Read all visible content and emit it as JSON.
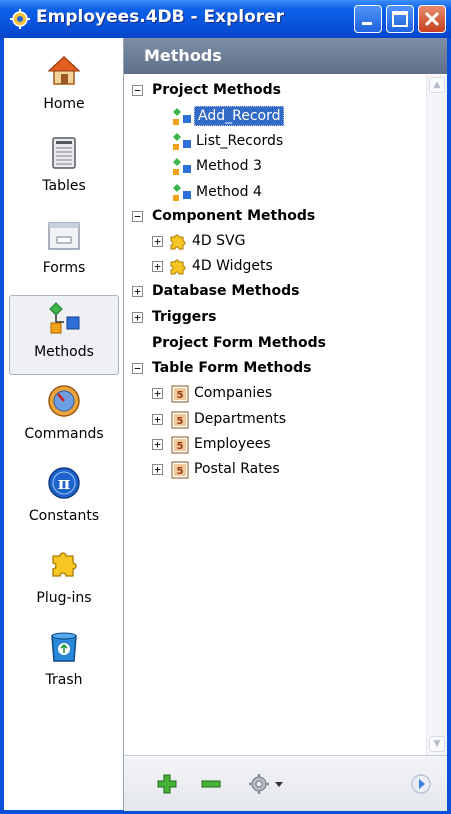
{
  "window": {
    "title": "Employees.4DB - Explorer",
    "accent": "#0a56de"
  },
  "nav": {
    "items": [
      {
        "label": "Home",
        "icon": "home-icon"
      },
      {
        "label": "Tables",
        "icon": "tables-icon"
      },
      {
        "label": "Forms",
        "icon": "forms-icon"
      },
      {
        "label": "Methods",
        "icon": "methods-icon",
        "selected": true
      },
      {
        "label": "Commands",
        "icon": "commands-icon"
      },
      {
        "label": "Constants",
        "icon": "constants-icon"
      },
      {
        "label": "Plug-ins",
        "icon": "plugins-icon"
      },
      {
        "label": "Trash",
        "icon": "trash-icon"
      }
    ]
  },
  "panel": {
    "header": "Methods",
    "tree": {
      "project_methods": {
        "label": "Project Methods",
        "expanded": true,
        "items": [
          "Add_Record",
          "List_Records",
          "Method 3",
          "Method 4"
        ],
        "selected": "Add_Record"
      },
      "component_methods": {
        "label": "Component Methods",
        "expanded": true,
        "items": [
          "4D SVG",
          "4D Widgets"
        ]
      },
      "database_methods": {
        "label": "Database Methods",
        "expanded": false
      },
      "triggers": {
        "label": "Triggers",
        "expanded": false
      },
      "project_form_methods": {
        "label": "Project Form Methods"
      },
      "table_form_methods": {
        "label": "Table Form Methods",
        "expanded": true,
        "items": [
          "Companies",
          "Departments",
          "Employees",
          "Postal Rates"
        ]
      }
    }
  },
  "toolbar": {
    "buttons": [
      "add-icon",
      "remove-icon",
      "gear-icon",
      "chevron-down-icon",
      "play-icon"
    ]
  }
}
